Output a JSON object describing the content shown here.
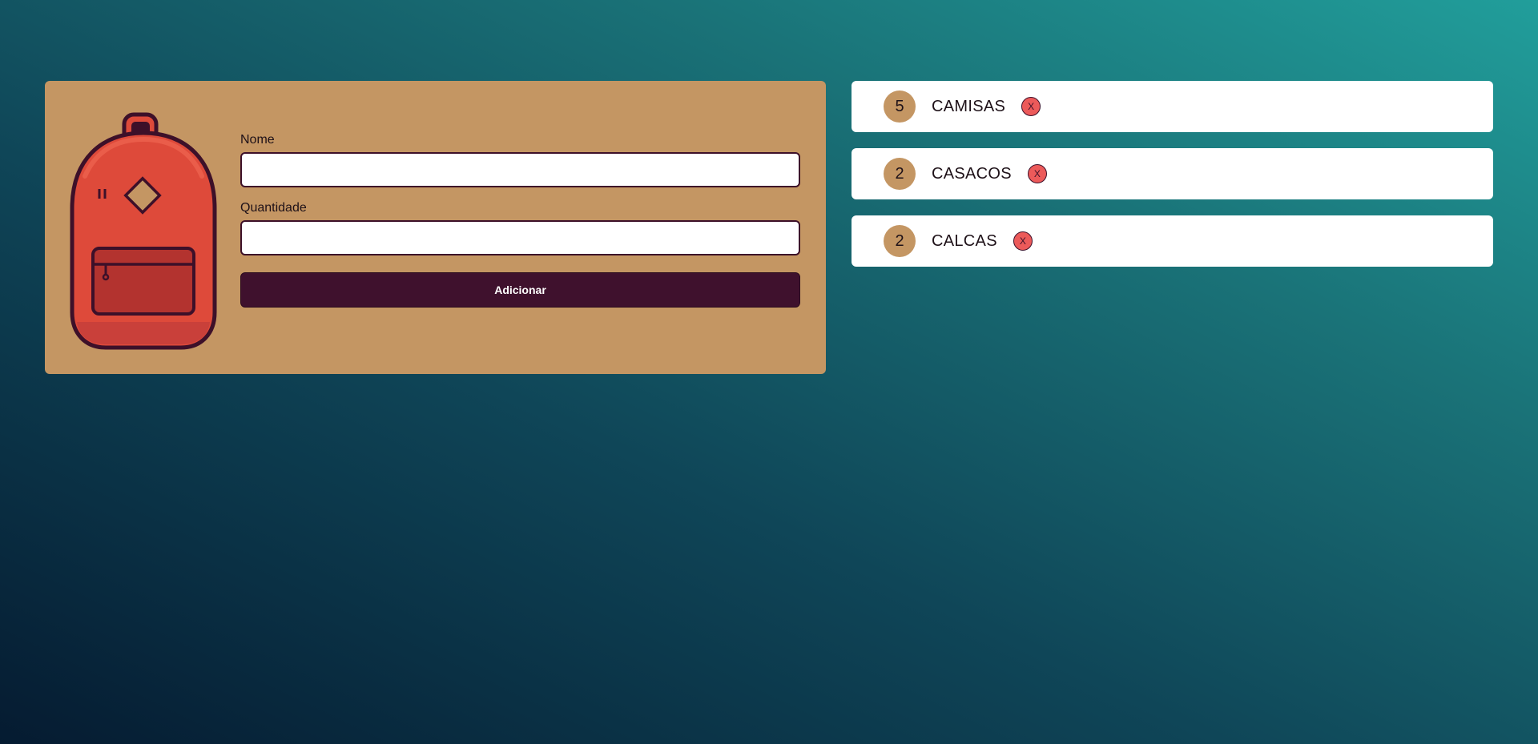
{
  "form": {
    "name_label": "Nome",
    "name_value": "",
    "quantity_label": "Quantidade",
    "quantity_value": "",
    "submit_label": "Adicionar"
  },
  "items": [
    {
      "quantity": "5",
      "name": "CAMISAS",
      "remove_label": "X"
    },
    {
      "quantity": "2",
      "name": "CASACOS",
      "remove_label": "X"
    },
    {
      "quantity": "2",
      "name": "CALCAS",
      "remove_label": "X"
    }
  ],
  "illustration": {
    "icon": "backpack-icon"
  },
  "colors": {
    "card": "#c49663",
    "button": "#3f112d",
    "remove": "#ec5a5a",
    "backpack_body": "#de4a3a"
  }
}
